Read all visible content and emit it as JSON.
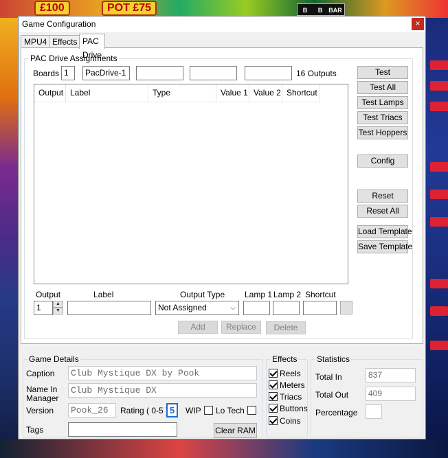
{
  "window": {
    "title": "Game Configuration",
    "close_glyph": "×"
  },
  "tabs": [
    {
      "label": "MPU4"
    },
    {
      "label": "Effects"
    },
    {
      "label": "PAC Drive"
    }
  ],
  "pac_drive": {
    "group_label": "PAC Drive Assignments",
    "boards_label": "Boards",
    "boards_value": "1",
    "boards_name": "PacDrive-1",
    "outputs_label": "16 Outputs",
    "columns": [
      "Output",
      "Label",
      "Type",
      "Value 1",
      "Value 2",
      "Shortcut"
    ],
    "rows": [],
    "buttons": {
      "test": "Test",
      "test_all": "Test All",
      "test_lamps": "Test Lamps",
      "test_triacs": "Test Triacs",
      "test_hoppers": "Test Hoppers",
      "config": "Config",
      "reset": "Reset",
      "reset_all": "Reset All",
      "load_template": "Load Template",
      "save_template": "Save Template",
      "add": "Add",
      "replace": "Replace",
      "delete": "Delete"
    },
    "editor": {
      "output_label": "Output",
      "label_label": "Label",
      "type_label": "Output Type",
      "lamp1_label": "Lamp 1",
      "lamp2_label": "Lamp 2",
      "shortcut_label": "Shortcut",
      "output_value": "1",
      "type_value": "Not Assigned"
    }
  },
  "game_details": {
    "group_label": "Game Details",
    "caption_label": "Caption",
    "caption_value": "Club Mystique DX by Pook",
    "name_label": "Name In",
    "manager_label": "Manager",
    "name_value": "Club Mystique DX",
    "version_label": "Version",
    "version_value": "Pook_26",
    "rating_label": "Rating ( 0-5 )",
    "rating_value": "5",
    "wip_label": "WIP",
    "wip_checked": false,
    "lotech_label": "Lo Tech",
    "lotech_checked": false,
    "tags_label": "Tags",
    "tags_value": "",
    "clear_ram": "Clear RAM"
  },
  "effects": {
    "group_label": "Effects",
    "items": [
      {
        "label": "Reels",
        "checked": true
      },
      {
        "label": "Meters",
        "checked": true
      },
      {
        "label": "Triacs",
        "checked": true
      },
      {
        "label": "Buttons",
        "checked": true
      },
      {
        "label": "Coins",
        "checked": true
      }
    ]
  },
  "statistics": {
    "group_label": "Statistics",
    "total_in_label": "Total In",
    "total_in_value": "837",
    "total_out_label": "Total Out",
    "total_out_value": "409",
    "percentage_label": "Percentage",
    "percentage_value": ""
  },
  "background": {
    "coin_text_1": "£100",
    "coin_text_2": "POT £75",
    "reel_symbols": [
      "B",
      "B",
      "BAR"
    ],
    "accent_colors": {
      "window_close": "#c42b1c",
      "rating_border": "#1a6cd6"
    }
  }
}
